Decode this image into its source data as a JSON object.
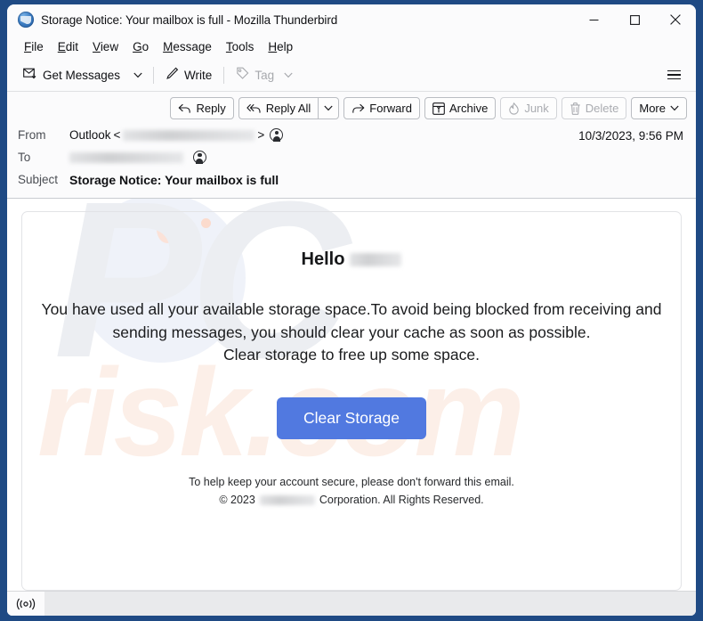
{
  "window": {
    "title": "Storage Notice: Your mailbox is full - Mozilla Thunderbird",
    "app_icon": "thunderbird-icon",
    "controls": {
      "minimize": "minimize-icon",
      "maximize": "maximize-icon",
      "close": "close-icon"
    }
  },
  "menubar": {
    "items": [
      {
        "label": "File",
        "accel": "F"
      },
      {
        "label": "Edit",
        "accel": "E"
      },
      {
        "label": "View",
        "accel": "V"
      },
      {
        "label": "Go",
        "accel": "G"
      },
      {
        "label": "Message",
        "accel": "M"
      },
      {
        "label": "Tools",
        "accel": "T"
      },
      {
        "label": "Help",
        "accel": "H"
      }
    ]
  },
  "toolbar": {
    "get_messages": "Get Messages",
    "get_messages_icon": "download-mail-icon",
    "get_messages_caret": "chevron-down-icon",
    "write": "Write",
    "write_icon": "pencil-icon",
    "tag": "Tag",
    "tag_icon": "tag-icon",
    "tag_caret": "chevron-down-icon",
    "tag_disabled": true,
    "app_menu_icon": "hamburger-icon"
  },
  "message_actions": [
    {
      "label": "Reply",
      "icon": "reply-arrow-icon",
      "disabled": false
    },
    {
      "label": "Reply All",
      "icon": "reply-all-arrow-icon",
      "disabled": false,
      "caret": "chevron-down-icon"
    },
    {
      "label": "Forward",
      "icon": "forward-arrow-icon",
      "disabled": false
    },
    {
      "label": "Archive",
      "icon": "archive-box-icon",
      "disabled": false
    },
    {
      "label": "Junk",
      "icon": "flame-icon",
      "disabled": true
    },
    {
      "label": "Delete",
      "icon": "trash-icon",
      "disabled": true
    },
    {
      "label": "More",
      "icon": "chevron-down-icon",
      "disabled": false
    }
  ],
  "message_header": {
    "from_label": "From",
    "from_name": "Outlook",
    "from_open_bracket": "<",
    "from_address_redacted": true,
    "from_close_bracket": ">",
    "from_avatar_icon": "contact-avatar-icon",
    "to_label": "To",
    "to_address_redacted": true,
    "to_avatar_icon": "contact-avatar-icon",
    "subject_label": "Subject",
    "subject": "Storage Notice: Your mailbox is full",
    "date": "10/3/2023, 9:56 PM"
  },
  "email_body": {
    "greeting": "Hello",
    "greeting_name_redacted": true,
    "paragraph_line1": "You have used all your available storage space.To avoid being blocked from receiving and",
    "paragraph_line2": "sending messages, you should clear your cache as soon as possible.",
    "paragraph_line3": "Clear storage to free up some space.",
    "cta_label": "Clear Storage",
    "cta_color": "#5179e0",
    "footnote_line1": "To help keep your account secure, please don't forward this email.",
    "footnote_copyright_prefix": "© 2023",
    "footnote_company_redacted": true,
    "footnote_copyright_suffix": "Corporation. All Rights Reserved.",
    "watermark_primary": "PC",
    "watermark_secondary": "risk.com"
  },
  "statusbar": {
    "connection_icon": "broadcast-online-icon"
  },
  "colors": {
    "window_border": "#1f4a84",
    "chrome_bg": "#fbfbfc",
    "cta_blue": "#5179e0",
    "statusbar_bg": "#e9eaec"
  }
}
